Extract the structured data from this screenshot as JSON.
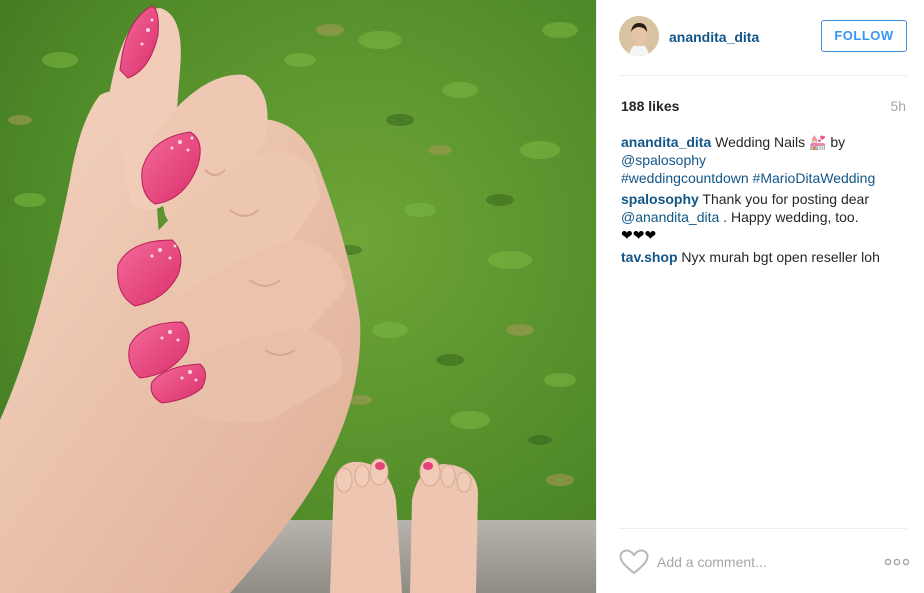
{
  "post": {
    "username": "anandita_dita",
    "follow_label": "FOLLOW",
    "likes": "188 likes",
    "time_ago": "5h"
  },
  "comments": [
    {
      "user": "anandita_dita",
      "text_a": " Wedding Nails ",
      "emoji": "💒",
      "text_b": " by ",
      "mention": "@spalosophy",
      "hashtag_1": "#weddingcountdown",
      "hashtag_2": "#MarioDitaWedding"
    },
    {
      "user": "spalosophy",
      "text_a": " Thank you for posting dear ",
      "mention": "@anandita_dita",
      "text_b": " . Happy wedding, too.",
      "hearts": "❤❤❤"
    },
    {
      "user": "tav.shop",
      "text_a": " Nyx murah bgt open reseller loh"
    }
  ],
  "comment_box": {
    "placeholder": "Add a comment..."
  },
  "icons": {
    "like": "heart-outline-icon",
    "more": "more-options-icon"
  },
  "colors": {
    "link": "#125688",
    "follow": "#3897f0",
    "nail_polish": "#e5427a"
  }
}
